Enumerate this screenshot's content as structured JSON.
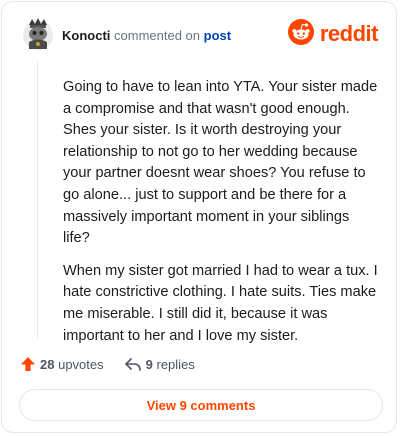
{
  "comment": {
    "author": "Konocti",
    "action_text": "commented on",
    "link_text": "post",
    "avatar_icon": "snoo-avatar-icon",
    "paragraphs": [
      "Going to have to lean into YTA. Your sister made a compromise and that wasn't good enough. Shes your sister. Is it worth destroying your relationship to not go to her wedding because your partner doesnt wear shoes? You refuse to go alone... just to support and be there for a massively important moment in your siblings life?",
      "When my sister got married I had to wear a tux. I hate constrictive clothing. I hate suits. Ties make me miserable. I still did it, because it was important to her and I love my sister."
    ]
  },
  "brand": {
    "name": "reddit",
    "icon": "reddit-logo-icon",
    "color": "#ff4500"
  },
  "actions": {
    "upvotes_count": "28",
    "upvotes_label": "upvotes",
    "upvote_icon": "upvote-arrow-icon",
    "replies_count": "9",
    "replies_label": "replies",
    "reply_icon": "reply-arrow-icon"
  },
  "footer": {
    "view_button": "View 9 comments"
  },
  "colors": {
    "accent": "#ff4500",
    "link": "#0045ac",
    "text": "#1c1c1c",
    "muted": "#6b7280"
  }
}
